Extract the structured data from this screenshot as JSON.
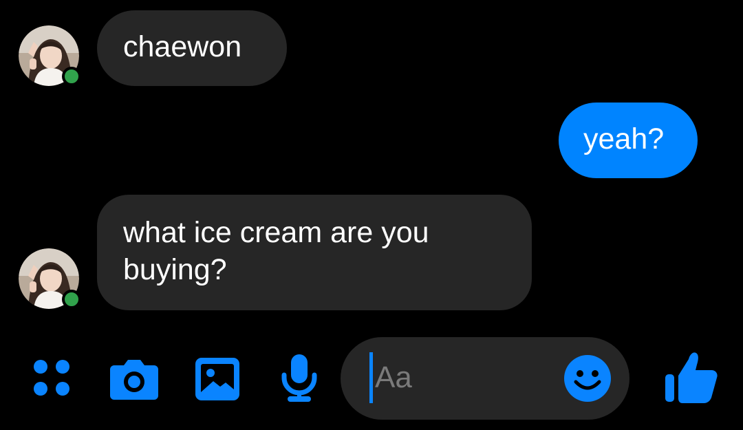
{
  "conversation": {
    "contact_avatar_icon": "profile-photo",
    "online_color": "#31a24c",
    "messages": [
      {
        "direction": "incoming",
        "text": "chaewon"
      },
      {
        "direction": "outgoing",
        "text": "yeah?"
      },
      {
        "direction": "incoming",
        "text": "what ice cream are you buying?"
      }
    ]
  },
  "composer": {
    "placeholder": "Aa",
    "accent_color": "#0a84ff",
    "tools": [
      {
        "name": "menu-dots-icon"
      },
      {
        "name": "camera-icon"
      },
      {
        "name": "gallery-icon"
      },
      {
        "name": "microphone-icon"
      }
    ],
    "emoji_icon": "emoji-smile-icon",
    "send_icon": "thumbs-up-icon"
  },
  "colors": {
    "background": "#000000",
    "incoming_bubble": "#262626",
    "outgoing_bubble": "#0084ff"
  }
}
